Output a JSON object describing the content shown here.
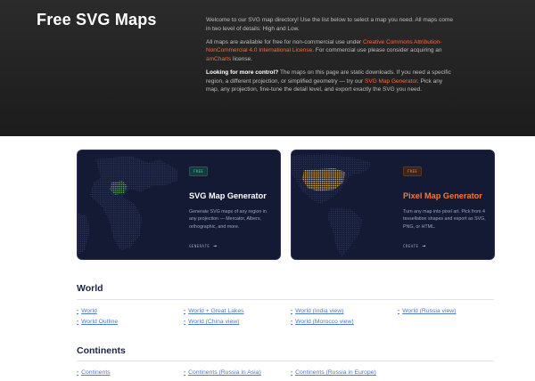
{
  "hero": {
    "title": "Free SVG Maps",
    "p1": "Welcome to our SVG map directory! Use the list below to select a map you need. All maps come in two level of details: High and Low.",
    "p2_a": "All maps are available for free for non-commercial use under ",
    "p2_link": "Creative Commons Attribution-NonCommercial 4.0 International License",
    "p2_b": ". For commercial use please consider acquiring an ",
    "p2_link2": "amCharts",
    "p2_c": " license.",
    "p3_bold": "Looking for more control?",
    "p3_a": " The maps on this page are static downloads. If you need a specific region, a different projection, or simplified geometry — try our ",
    "p3_link": "SVG Map Generator",
    "p3_b": ". Pick any map, any projection, fine-tune the detail level, and export exactly the SVG you need."
  },
  "cards": [
    {
      "badge": "FREE",
      "title": "SVG Map Generator",
      "desc": "Generate SVG maps of any region in any projection — Mercator, Albers, orthographic, and more.",
      "cta": "GENERATE"
    },
    {
      "badge": "FREE",
      "title": "Pixel Map Generator",
      "desc": "Turn any map into pixel art. Pick from 4 tessellation shapes and export as SVG, PNG, or HTML.",
      "cta": "CREATE"
    }
  ],
  "sections": {
    "world": {
      "title": "World",
      "links": [
        "World",
        "World + Great Lakes",
        "World (India view)",
        "World (Russia view)",
        "World Outline",
        "World (China view)",
        "World (Morocco view)"
      ]
    },
    "continents": {
      "title": "Continents",
      "links": [
        "Continents",
        "Continents (Russia in Asia)",
        "Continents (Russia in Europe)"
      ]
    }
  },
  "icons": {
    "arrow": "arrow-right-icon",
    "bullet": "bullet-icon"
  },
  "colors": {
    "accent": "#f26b3a",
    "link": "#4f79c9",
    "card_bg": "#141a33",
    "teal": "#3fd0b0"
  }
}
